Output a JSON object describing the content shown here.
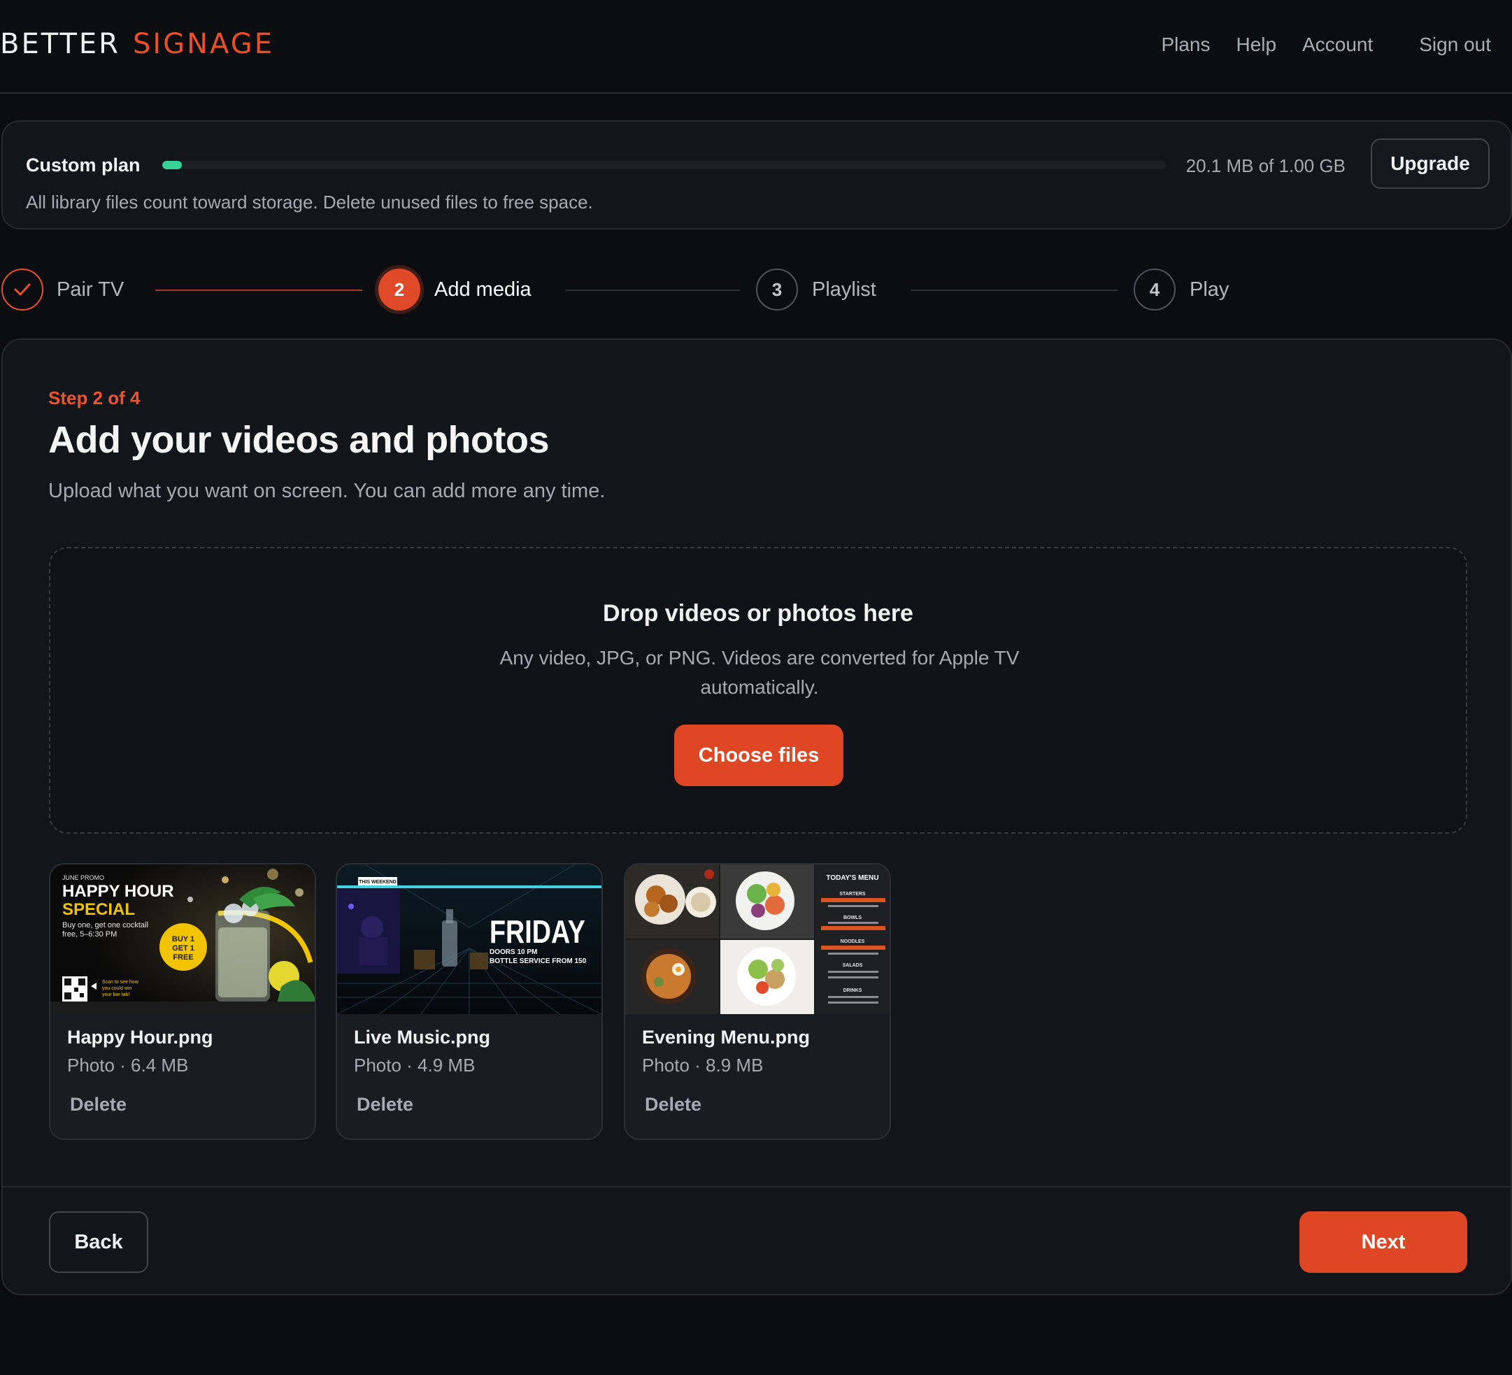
{
  "brand": {
    "word1": "BETTER",
    "word2": "SIGNAGE"
  },
  "nav": {
    "plans": "Plans",
    "help": "Help",
    "account": "Account",
    "signout": "Sign out"
  },
  "plan": {
    "name": "Custom plan",
    "usage_text": "20.1 MB of 1.00 GB",
    "used_fraction": 0.0196,
    "upgrade_label": "Upgrade",
    "note": "All library files count toward storage. Delete unused files to free space."
  },
  "stepper": {
    "steps": [
      {
        "number": "1",
        "label": "Pair TV",
        "state": "done"
      },
      {
        "number": "2",
        "label": "Add media",
        "state": "current"
      },
      {
        "number": "3",
        "label": "Playlist",
        "state": "todo"
      },
      {
        "number": "4",
        "label": "Play",
        "state": "todo"
      }
    ]
  },
  "main": {
    "eyebrow": "Step 2 of 4",
    "title": "Add your videos and photos",
    "subtitle": "Upload what you want on screen. You can add more any time."
  },
  "dropzone": {
    "title": "Drop videos or photos here",
    "text": "Any video, JPG, or PNG. Videos are converted for Apple TV automatically.",
    "button_label": "Choose files"
  },
  "media": [
    {
      "name": "Happy Hour.png",
      "meta": "Photo · 6.4 MB",
      "delete_label": "Delete",
      "thumb": {
        "kicker": "JUNE PROMO",
        "line1": "HAPPY HOUR",
        "line2": "SPECIAL",
        "copy1": "Buy one, get one cocktail",
        "copy2": "free, 5–6:30 PM",
        "badge1": "BUY 1",
        "badge2": "GET 1",
        "badge3": "FREE",
        "scan1": "Scan to see how",
        "scan2": "you could win",
        "scan3": "your bar tab!"
      }
    },
    {
      "name": "Live Music.png",
      "meta": "Photo · 4.9 MB",
      "delete_label": "Delete",
      "thumb": {
        "kicker": "THIS WEEKEND",
        "headline": "FRIDAY",
        "line1": "DOORS 10 PM",
        "line2": "BOTTLE SERVICE FROM 150"
      }
    },
    {
      "name": "Evening Menu.png",
      "meta": "Photo · 8.9 MB",
      "delete_label": "Delete",
      "thumb": {
        "heading": "TODAY'S MENU",
        "sec1": "STARTERS",
        "sec2": "BOWLS",
        "sec3": "NOODLES",
        "sec4": "SALADS",
        "sec5": "DRINKS"
      }
    }
  ],
  "footer": {
    "back_label": "Back",
    "next_label": "Next"
  },
  "colors": {
    "accent": "#df4624",
    "progress": "#37d196",
    "background": "#0b0d10",
    "panel": "#12151a"
  }
}
